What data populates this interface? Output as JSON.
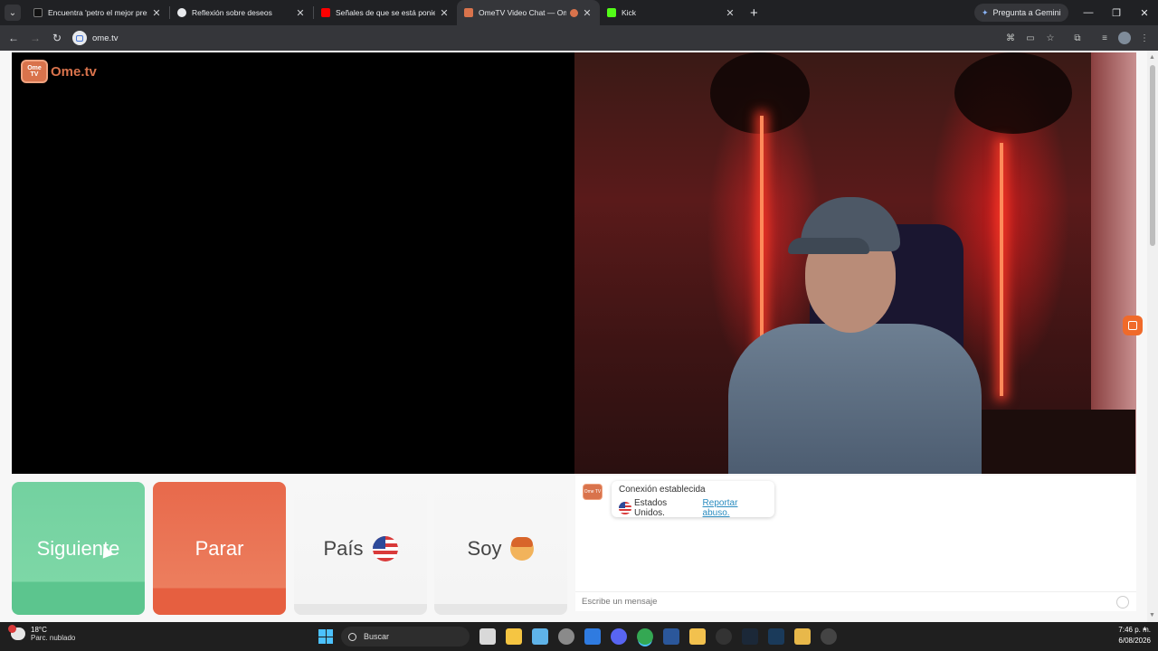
{
  "browser": {
    "tabs": [
      {
        "title": "Encuentra 'petro el mejor presi",
        "favicon_color": "#111111",
        "active": false
      },
      {
        "title": "Reflexión sobre deseos",
        "favicon_color": "#e8eaed",
        "active": false
      },
      {
        "title": "Señales de que se está poniend",
        "favicon_color": "#ff0000",
        "active": false
      },
      {
        "title": "OmeTV Video Chat — Ome",
        "favicon_color": "#d9734c",
        "active": true
      },
      {
        "title": "Kick",
        "favicon_color": "#53fc18",
        "active": false
      }
    ],
    "new_tab": "+",
    "gemini_label": "Pregunta a Gemini",
    "url": "ome.tv"
  },
  "page": {
    "logo_text": "Ome.tv",
    "logo_badge": "Ome TV",
    "buttons": {
      "next": "Siguiente",
      "stop": "Parar",
      "country": "País",
      "gender": "Soy"
    },
    "chat": {
      "status": "Conexión establecida",
      "country": "Estados Unidos.",
      "report": "Reportar abuso.",
      "input_placeholder": "Escribe un mensaje"
    },
    "colors": {
      "next": "#73d1a0",
      "stop": "#e8694b",
      "brand": "#d9734c"
    }
  },
  "taskbar": {
    "temperature": "18°C",
    "weather": "Parc. nublado",
    "search": "Buscar",
    "time": "7:46 p. m.",
    "date": "6/08/2026",
    "apps": [
      "file-explorer-icon",
      "store-icon",
      "photos-icon",
      "settings-icon",
      "defender-icon",
      "discord-icon",
      "chrome-icon",
      "word-icon",
      "folder-icon",
      "steam-alt-icon",
      "steam-icon",
      "app-icon",
      "notes-icon",
      "media-icon"
    ]
  }
}
